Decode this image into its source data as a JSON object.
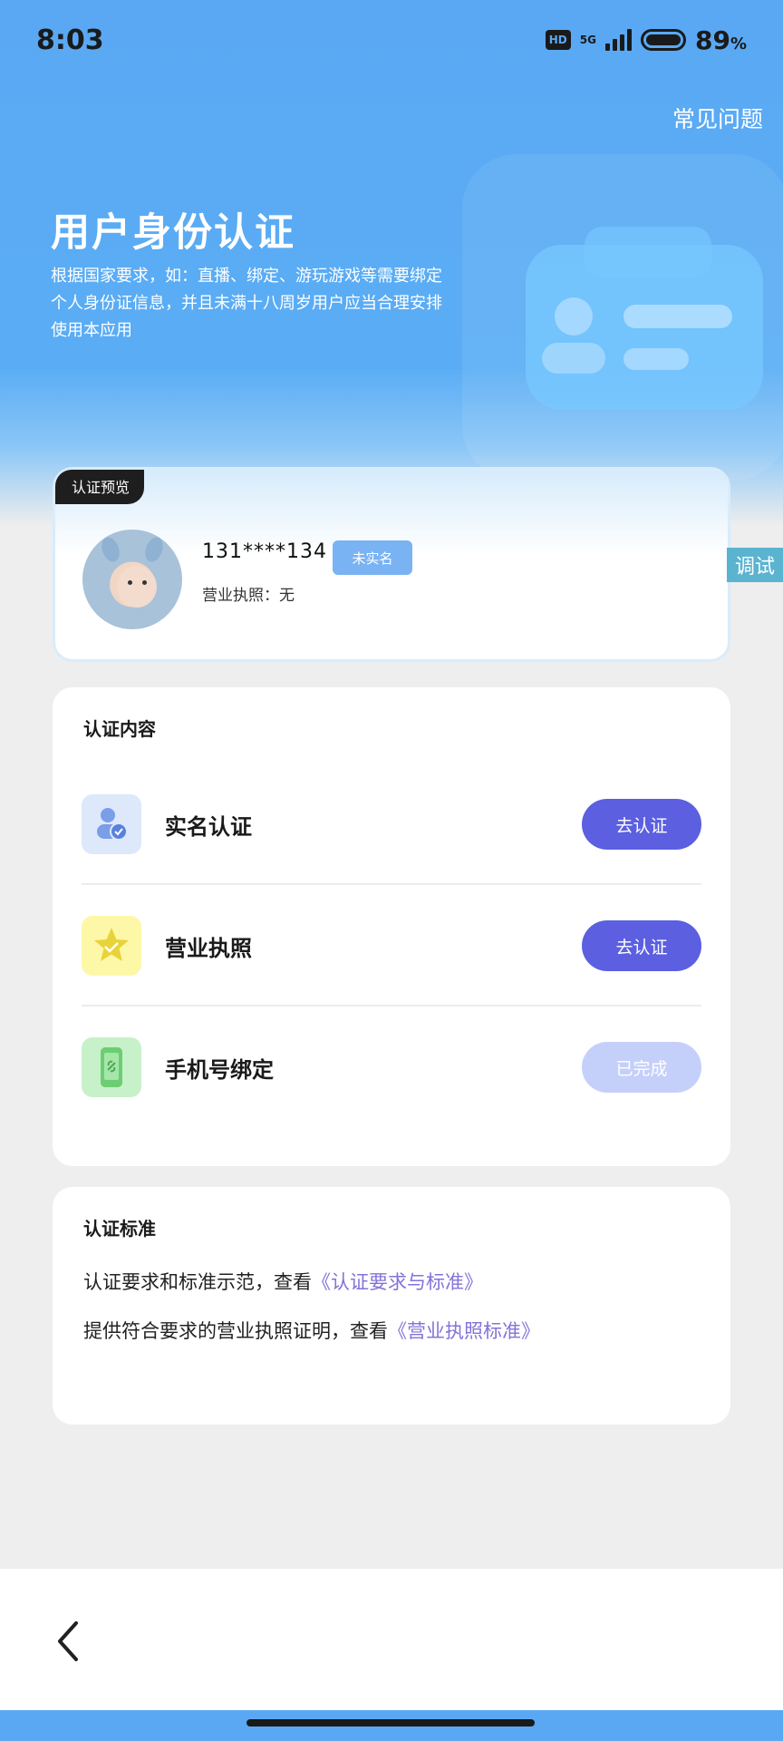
{
  "status_bar": {
    "time": "8:03",
    "hd": "HD",
    "network": "5G",
    "battery_percent": "89",
    "battery_unit": "%",
    "battery_level": 0.89
  },
  "header": {
    "faq_label": "常见问题",
    "title": "用户身份认证",
    "description": "根据国家要求，如：直播、绑定、游玩游戏等需要绑定个人身份证信息，并且未满十八周岁用户应当合理安排使用本应用"
  },
  "preview": {
    "tag": "认证预览",
    "phone": "131****134",
    "status_badge": "未实名",
    "license_line": "营业执照：无"
  },
  "debug_label": "调试",
  "content": {
    "title": "认证内容",
    "items": [
      {
        "label": "实名认证",
        "icon": "user-check-icon",
        "button": "去认证",
        "state": "pending"
      },
      {
        "label": "营业执照",
        "icon": "star-icon",
        "button": "去认证",
        "state": "pending"
      },
      {
        "label": "手机号绑定",
        "icon": "phone-link-icon",
        "button": "已完成",
        "state": "done"
      }
    ]
  },
  "standard": {
    "title": "认证标准",
    "line1_text": "认证要求和标准示范，查看",
    "line1_link": "《认证要求与标准》",
    "line2_text": "提供符合要求的营业执照证明，查看",
    "line2_link": "《营业执照标准》"
  },
  "colors": {
    "hero_blue": "#5aa8f3",
    "primary_button": "#5b5fe0",
    "done_button": "#c5d0fa",
    "link": "#8572d8",
    "badge": "#7ab3f3"
  }
}
